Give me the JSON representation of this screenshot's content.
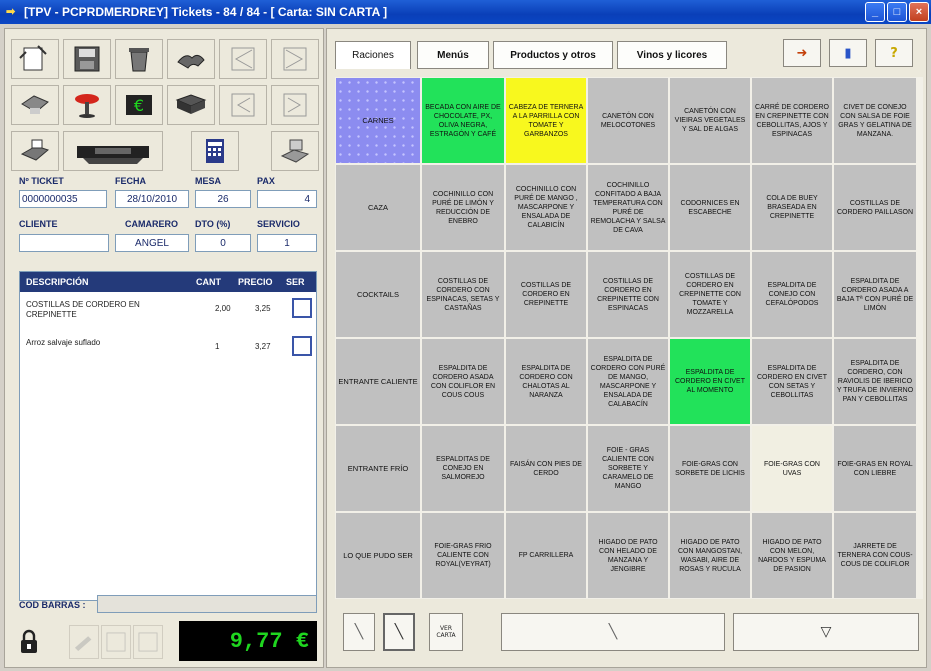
{
  "window": {
    "title": "[TPV - PCPRDMERDREY] Tickets - 84 / 84 - [ Carta: SIN CARTA ]",
    "buttons": [
      "minimize",
      "maximize",
      "close"
    ]
  },
  "ticket": {
    "labels": {
      "ticket": "Nº TICKET",
      "fecha": "FECHA",
      "mesa": "MESA",
      "pax": "PAX",
      "cliente": "CLIENTE",
      "camarero": "CAMARERO",
      "dto": "DTO (%)",
      "servicio": "SERVICIO"
    },
    "values": {
      "ticket": "0000000035",
      "fecha": "28/10/2010",
      "mesa": "26",
      "pax": "4",
      "cliente": "",
      "camarero": "ANGEL",
      "dto": "0",
      "servicio": "1"
    }
  },
  "lines_table": {
    "headers": [
      "DESCRIPCIÓN",
      "CANT",
      "PRECIO",
      "SER"
    ],
    "rows": [
      {
        "desc": "COSTILLAS DE CORDERO EN CREPINETTE",
        "cant": "2,00",
        "precio": "3,25"
      },
      {
        "desc": "Arroz salvaje suflado",
        "cant": "1",
        "precio": "3,27"
      }
    ]
  },
  "barcode_label": "COD BARRAS :",
  "total": "9,77 €",
  "tabs": [
    "Raciones",
    "Menús",
    "Productos y otros",
    "Vinos y licores"
  ],
  "categories": [
    "CARNES",
    "CAZA",
    "COCKTAILS",
    "ENTRANTE CALIENTE",
    "ENTRANTE FRÍO",
    "LO QUE PUDO SER"
  ],
  "products": [
    [
      "BECADA CON AIRE DE CHOCOLATE, PX, OLIVA NEGRA, ESTRAGÓN Y CAFÉ",
      "CABEZA DE TERNERA A LA PARRILLA CON TOMATE Y GARBANZOS",
      "CANETÓN CON MELOCOTONES",
      "CANETÓN CON VIEIRAS VEGETALES Y SAL DE ALGAS",
      "CARRÉ DE CORDERO EN CREPINETTE CON CEBOLLITAS, AJOS Y ESPINACAS",
      "CIVET DE CONEJO CON SALSA DE FOIE GRAS Y GELATINA DE MANZANA."
    ],
    [
      "COCHINILLO CON PURÉ DE LIMÓN Y REDUCCIÓN DE ENEBRO",
      "COCHINILLO CON PURÉ DE MANGO , MASCARPONE Y ENSALADA DE CALABICÍN",
      "COCHINILLO CONFITADO A BAJA TEMPERATURA CON PURÉ DE REMOLACHA Y SALSA DE CAVA",
      "CODORNICES EN ESCABECHE",
      "COLA DE BUEY BRASEADA EN CREPINETTE",
      "COSTILLAS DE CORDERO PAILLASON"
    ],
    [
      "COSTILLAS DE CORDERO CON ESPINACAS, SETAS Y CASTAÑAS",
      "COSTILLAS DE CORDERO EN CREPINETTE",
      "COSTILLAS DE CORDERO EN CREPINETTE CON ESPINACAS",
      "COSTILLAS DE CORDERO EN CREPINETTE CON TOMATE Y MOZZARELLA",
      "ESPALDITA DE CONEJO CON CEFALÓPODOS",
      "ESPALDITA DE CORDERO ASADA A BAJA Tª CON PURÉ DE LIMÓN"
    ],
    [
      "ESPALDITA DE CORDERO ASADA CON COLIFLOR EN COUS COUS",
      "ESPALDITA DE CORDERO CON CHALOTAS AL NARANZA",
      "ESPALDITA DE CORDERO CON PURÉ DE MANGO, MASCARPONE Y ENSALADA DE CALABACÍN",
      "ESPALDITA DE CORDERO EN CIVET AL MOMENTO",
      "ESPALDITA DE CORDERO EN CIVET CON SETAS Y CEBOLLITAS",
      "ESPALDITA DE CORDERO, CON RAVIOLIS DE IBERICO Y TRUFA DE INVIERNO PAN Y CEBOLLITAS"
    ],
    [
      "ESPALDITAS DE CONEJO EN SALMOREJO",
      "FAISÁN CON PIES DE CERDO",
      "FOIE - GRAS CALIENTE CON SORBETE Y CARAMELO DE MANGO",
      "FOIE-GRAS CON SORBETE DE LICHIS",
      "FOIE-GRAS CON UVAS",
      "FOIE-GRAS EN ROYAL CON LIEBRE"
    ],
    [
      "FOIE-GRAS FRIO CALIENTE CON ROYAL(VEYRAT)",
      "FP CARRILLERA",
      "HIGADO DE PATO CON HELADO DE MANZANA Y JENGIBRE",
      "HIGADO DE PATO CON MANGOSTAN, WASABI, AIRE DE ROSAS Y RUCULA",
      "HIGADO DE PATO CON MELON, NARDOS Y ESPUMA DE PASION",
      "JARRETE DE TERNERA CON COUS- COUS DE COLIFLOR"
    ]
  ],
  "highlight_colors": {
    "green": "#22e25a",
    "yellow": "#f8f81e",
    "cream": "#f1efe2",
    "grey": "#c0c0c0",
    "category_blue": "#8c8cf0"
  },
  "ver_carta": "VER CARTA",
  "icons": [
    "new-ticket-icon",
    "save-icon",
    "trash-icon",
    "handshake-icon",
    "first-icon",
    "last-icon",
    "printer-icon",
    "stool-icon",
    "euro-icon",
    "cash-drawer-icon",
    "prev-icon",
    "next-icon",
    "receipt-icon",
    "register-icon",
    "calculator-icon",
    "card-print-icon"
  ]
}
